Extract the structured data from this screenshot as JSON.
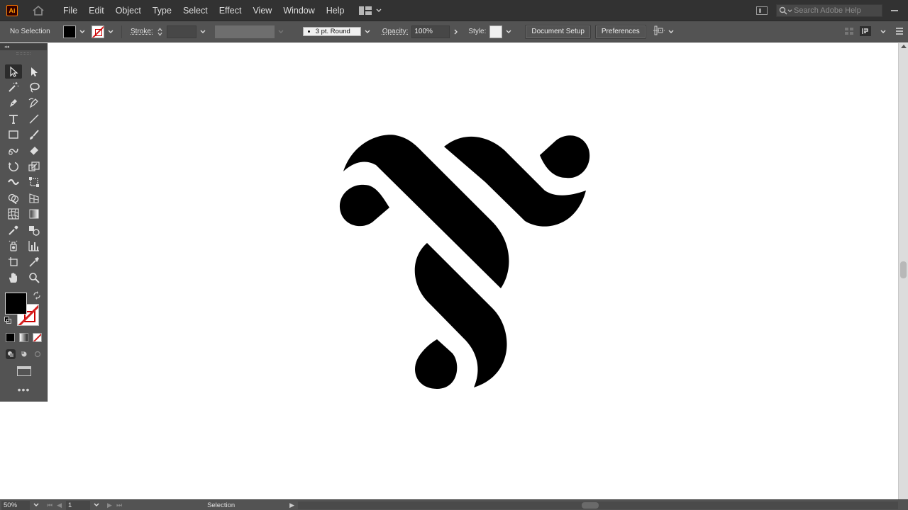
{
  "app": {
    "logo_text": "Ai",
    "brand_color": "#ff9a00"
  },
  "menubar": {
    "items": [
      {
        "label": "File"
      },
      {
        "label": "Edit"
      },
      {
        "label": "Object"
      },
      {
        "label": "Type"
      },
      {
        "label": "Select"
      },
      {
        "label": "Effect"
      },
      {
        "label": "View"
      },
      {
        "label": "Window"
      },
      {
        "label": "Help"
      }
    ],
    "search_placeholder": "Search Adobe Help"
  },
  "controlbar": {
    "selection_status": "No Selection",
    "stroke_label": "Stroke:",
    "brush_definition": "3 pt. Round",
    "opacity_label": "Opacity:",
    "opacity_value": "100%",
    "style_label": "Style:",
    "document_setup_label": "Document Setup",
    "preferences_label": "Preferences",
    "fill_color": "#000000",
    "stroke_color": "none"
  },
  "toolbar": {
    "tools": [
      {
        "name": "selection-tool",
        "icon": "arrow-icon",
        "active": true
      },
      {
        "name": "direct-selection-tool",
        "icon": "white-arrow-icon"
      },
      {
        "name": "magic-wand-tool",
        "icon": "magic-wand-icon"
      },
      {
        "name": "lasso-tool",
        "icon": "lasso-icon"
      },
      {
        "name": "pen-tool",
        "icon": "pen-icon"
      },
      {
        "name": "curvature-tool",
        "icon": "curvature-icon"
      },
      {
        "name": "type-tool",
        "icon": "type-icon"
      },
      {
        "name": "line-segment-tool",
        "icon": "line-icon"
      },
      {
        "name": "rectangle-tool",
        "icon": "rectangle-icon"
      },
      {
        "name": "paintbrush-tool",
        "icon": "brush-icon"
      },
      {
        "name": "shaper-tool",
        "icon": "shaper-icon"
      },
      {
        "name": "eraser-tool",
        "icon": "eraser-icon"
      },
      {
        "name": "rotate-tool",
        "icon": "rotate-icon"
      },
      {
        "name": "scale-tool",
        "icon": "scale-icon"
      },
      {
        "name": "width-tool",
        "icon": "width-icon"
      },
      {
        "name": "free-transform-tool",
        "icon": "free-transform-icon"
      },
      {
        "name": "shape-builder-tool",
        "icon": "shape-builder-icon"
      },
      {
        "name": "perspective-grid-tool",
        "icon": "perspective-icon"
      },
      {
        "name": "mesh-tool",
        "icon": "mesh-icon"
      },
      {
        "name": "gradient-tool",
        "icon": "gradient-icon"
      },
      {
        "name": "eyedropper-tool",
        "icon": "eyedropper-icon"
      },
      {
        "name": "blend-tool",
        "icon": "blend-icon"
      },
      {
        "name": "symbol-sprayer-tool",
        "icon": "symbol-sprayer-icon"
      },
      {
        "name": "column-graph-tool",
        "icon": "graph-icon"
      },
      {
        "name": "artboard-tool",
        "icon": "artboard-icon"
      },
      {
        "name": "slice-tool",
        "icon": "slice-icon"
      },
      {
        "name": "hand-tool",
        "icon": "hand-icon"
      },
      {
        "name": "zoom-tool",
        "icon": "zoom-icon"
      }
    ],
    "edit_toolbar_glyph": "•••"
  },
  "artwork": {
    "fill_color": "#000000"
  },
  "statusbar": {
    "zoom": "50%",
    "artboard_number": "1",
    "status_text": "Selection"
  }
}
